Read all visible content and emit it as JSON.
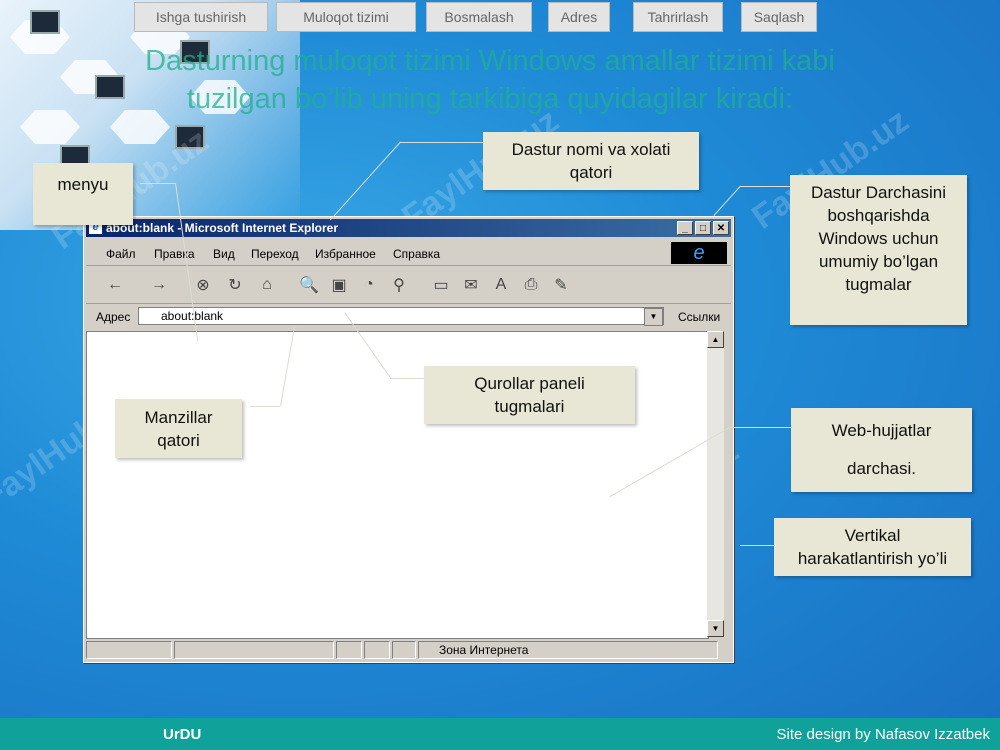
{
  "nav": [
    "Ishga tushirish",
    "Muloqot tizimi",
    "Bosmalash",
    "Adres",
    "Tahrirlash",
    "Saqlash"
  ],
  "title": {
    "line1": "Dasturning muloqot tizimi Windows amallar tizimi kabi",
    "line2": "tuzilgan bo’lib uning tarkibiga quyidagilar kiradi:"
  },
  "callouts": {
    "menyu": "menyu",
    "dastur_nomi_1": "Dastur nomi va xolati",
    "dastur_nomi_2": "qatori",
    "darcha_1": "Dastur Darchasini",
    "darcha_2": "boshqarishda",
    "darcha_3": "Windows uchun",
    "darcha_4": "umumiy bo’lgan",
    "darcha_5": "tugmalar",
    "qurollar_1": "Qurollar paneli",
    "qurollar_2": "tugmalari",
    "manzillar_1": "Manzillar",
    "manzillar_2": "qatori",
    "web_1": "Web-hujjatlar",
    "web_2": "darchasi.",
    "vert_1": "Vertikal",
    "vert_2": "harakatlantirish yo’li"
  },
  "browser": {
    "title": "about:blank - Microsoft Internet Explorer",
    "menu": [
      "Файл",
      "Правка",
      "Вид",
      "Переход",
      "Избранное",
      "Справка"
    ],
    "address_label": "Адрес",
    "address_value": "about:blank",
    "links_label": "Ссылки",
    "status_zone": "Зона Интернета"
  },
  "watermark": "FaylHub.uz",
  "footer": {
    "left": "UrDU",
    "right": "Site design by Nafasov Izzatbek"
  },
  "colors": {
    "title_text": "#1fb08f",
    "footer_bg": "#10a29a",
    "ie_titlebar": "#0a246a"
  },
  "icons": [
    "back-icon",
    "forward-icon",
    "stop-icon",
    "refresh-icon",
    "home-icon",
    "search-icon",
    "favorites-icon",
    "history-icon",
    "channels-icon",
    "fullscreen-icon",
    "mail-icon",
    "font-icon",
    "print-icon",
    "edit-icon",
    "ie-logo-icon"
  ]
}
